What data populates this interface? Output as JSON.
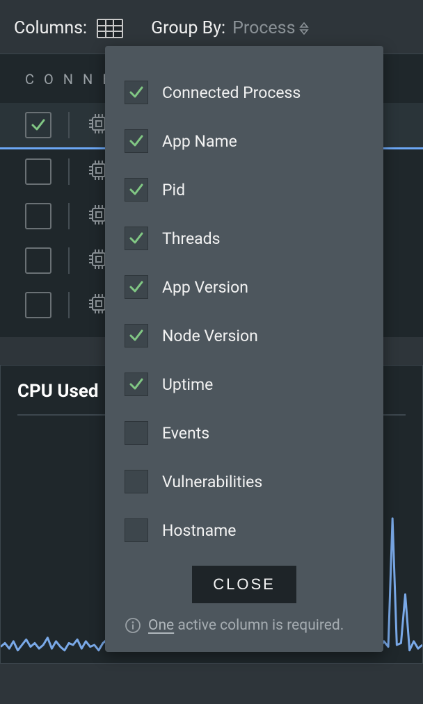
{
  "toolbar": {
    "columns_label": "Columns:",
    "groupby_label": "Group By:",
    "groupby_value": "Process"
  },
  "table": {
    "header": "CONNEC",
    "rows": [
      {
        "checked": true
      },
      {
        "checked": false
      },
      {
        "checked": false
      },
      {
        "checked": false
      },
      {
        "checked": false
      }
    ]
  },
  "chart": {
    "title": "CPU Used"
  },
  "chart_data": {
    "type": "line",
    "title": "CPU Used",
    "xlabel": "",
    "ylabel": "",
    "ylim": [
      0,
      100
    ],
    "x": [
      0,
      1,
      2,
      3,
      4,
      5,
      6,
      7,
      8,
      9,
      10,
      11,
      12,
      13,
      14,
      15,
      16,
      17,
      18,
      19,
      20,
      21,
      22,
      23,
      24,
      25,
      26,
      27,
      28,
      29,
      30,
      31,
      32,
      33,
      34,
      35,
      36,
      37,
      38,
      39,
      40,
      41,
      42,
      43,
      44,
      45,
      46,
      47,
      48,
      49,
      50,
      51,
      52,
      53,
      54,
      55,
      56,
      57,
      58,
      59,
      60,
      61,
      62,
      63,
      64,
      65,
      66,
      67,
      68,
      69,
      70,
      71,
      72,
      73,
      74,
      75,
      76,
      77,
      78,
      79,
      80,
      81,
      82,
      83,
      84,
      85,
      86,
      87,
      88,
      89,
      90,
      91,
      92,
      93,
      94,
      95,
      96,
      97,
      98,
      99
    ],
    "values": [
      9,
      11,
      8,
      12,
      7,
      10,
      13,
      9,
      11,
      8,
      10,
      14,
      8,
      12,
      9,
      7,
      11,
      10,
      13,
      8,
      12,
      9,
      10,
      7,
      11,
      13,
      10,
      8,
      12,
      9,
      7,
      11,
      10,
      12,
      8,
      11,
      9,
      13,
      7,
      12,
      10,
      8,
      11,
      9,
      13,
      7,
      10,
      12,
      8,
      11,
      9,
      10,
      7,
      12,
      8,
      11,
      9,
      13,
      10,
      7,
      12,
      9,
      11,
      8,
      10,
      13,
      9,
      12,
      7,
      11,
      8,
      10,
      12,
      9,
      7,
      11,
      13,
      8,
      12,
      10,
      9,
      11,
      8,
      13,
      7,
      10,
      12,
      9,
      11,
      8,
      12,
      9,
      80,
      10,
      11,
      38,
      7,
      12,
      8,
      10
    ]
  },
  "popup": {
    "items": [
      {
        "label": "Connected Process",
        "checked": true
      },
      {
        "label": "App Name",
        "checked": true
      },
      {
        "label": "Pid",
        "checked": true
      },
      {
        "label": "Threads",
        "checked": true
      },
      {
        "label": "App Version",
        "checked": true
      },
      {
        "label": "Node Version",
        "checked": true
      },
      {
        "label": "Uptime",
        "checked": true
      },
      {
        "label": "Events",
        "checked": false
      },
      {
        "label": "Vulnerabilities",
        "checked": false
      },
      {
        "label": "Hostname",
        "checked": false
      }
    ],
    "close_label": "CLOSE",
    "hint_link": "One",
    "hint_rest": " active column is required."
  },
  "colors": {
    "check_green": "#81c784",
    "chart_line": "#7aa9e8"
  }
}
